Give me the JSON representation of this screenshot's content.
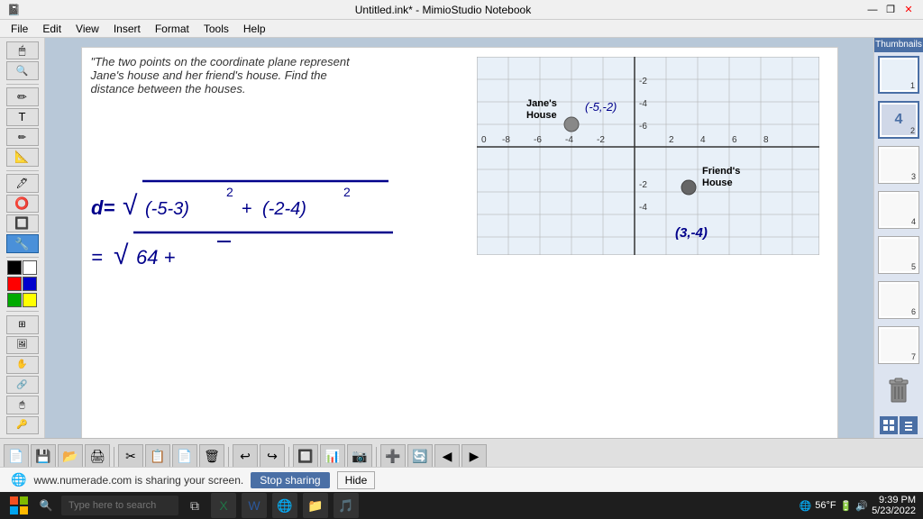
{
  "titlebar": {
    "title": "Untitled.ink* - MimioStudio Notebook",
    "minimize": "—",
    "restore": "❐",
    "close": "✕"
  },
  "menubar": {
    "items": [
      "File",
      "Edit",
      "View",
      "Insert",
      "Format",
      "Tools",
      "Help"
    ]
  },
  "thumbnails": {
    "header": "Thumbnails",
    "items": [
      {
        "num": "1",
        "active": true
      },
      {
        "num": "2"
      },
      {
        "num": "3"
      },
      {
        "num": "4"
      },
      {
        "num": "5"
      },
      {
        "num": "6"
      },
      {
        "num": "7"
      }
    ]
  },
  "notebook": {
    "problem_text": "\"The two points on the coordinate plane represent Jane's house and her friend's house. Find the distance between the houses.",
    "jane_coords": "(-5, -2)",
    "friend_coords": "(3, -4)",
    "jane_label": "Jane's House",
    "friend_label": "Friend's House"
  },
  "notification": {
    "icon": "🌐",
    "text": "www.numerade.com is sharing your screen.",
    "stop_label": "Stop sharing",
    "hide_label": "Hide"
  },
  "bottom_toolbar": {
    "buttons": [
      "💾",
      "📂",
      "🖨",
      "✂",
      "📋",
      "📄",
      "🗑",
      "↩",
      "↪",
      "🔲",
      "📊",
      "📷",
      "➕",
      "🔄"
    ]
  },
  "taskbar": {
    "start_icon": "⊞",
    "search_placeholder": "Type here to search",
    "time": "9:39 PM",
    "date": "5/23/2022",
    "temperature": "56°F",
    "apps": [
      "⊞",
      "📋",
      "🌐",
      "📁",
      "🎵"
    ]
  },
  "tools": {
    "items": [
      "🖱",
      "🔍",
      "✏",
      "T",
      "✏",
      "📐",
      "🖊",
      "⭕",
      "🔲",
      "🖌",
      "🔧",
      "⬛"
    ]
  },
  "colors": {
    "black": "#000000",
    "white": "#ffffff",
    "red": "#ff0000",
    "blue": "#0000ff",
    "green": "#00aa00",
    "yellow": "#ffff00"
  }
}
